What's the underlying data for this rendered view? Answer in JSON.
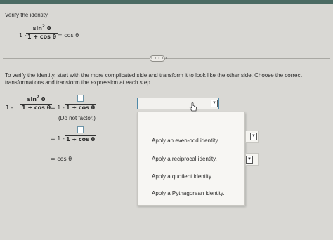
{
  "prompt": {
    "title": "Verify the identity.",
    "identity_lhs_prefix": "1 -",
    "identity_numerator": "sin",
    "identity_sup": "2",
    "identity_theta": "θ",
    "identity_denominator": "1 + cos θ",
    "identity_rhs": "= cos θ"
  },
  "more_button": "•••••",
  "instructions_line1": "To verify the identity, start with the more complicated side and transform it to look like the other side.  Choose the correct",
  "instructions_line2": "transformations and transform the expression at each step.",
  "steps": {
    "s1_prefix": "1 -",
    "s1_numerator": "sin",
    "s1_sup": "2",
    "s1_theta": "θ",
    "s1_denominator": "1 + cos θ",
    "s1_eq": "= 1 -",
    "s1_blank_denominator": "1 + cos θ",
    "s1_note": "(Do not factor.)",
    "s2_eq": "= 1 -",
    "s2_blank_denominator": "1 + cos θ",
    "s3": "= cos θ"
  },
  "dropdown": {
    "options": [
      "Apply an even-odd identity.",
      "Apply a reciprocal identity.",
      "Apply a quotient identity.",
      "Apply a Pythagorean identity."
    ]
  },
  "icons": {
    "select_arrow": "dropdown-arrow-icon",
    "cursor": "hand-pointer-icon"
  }
}
